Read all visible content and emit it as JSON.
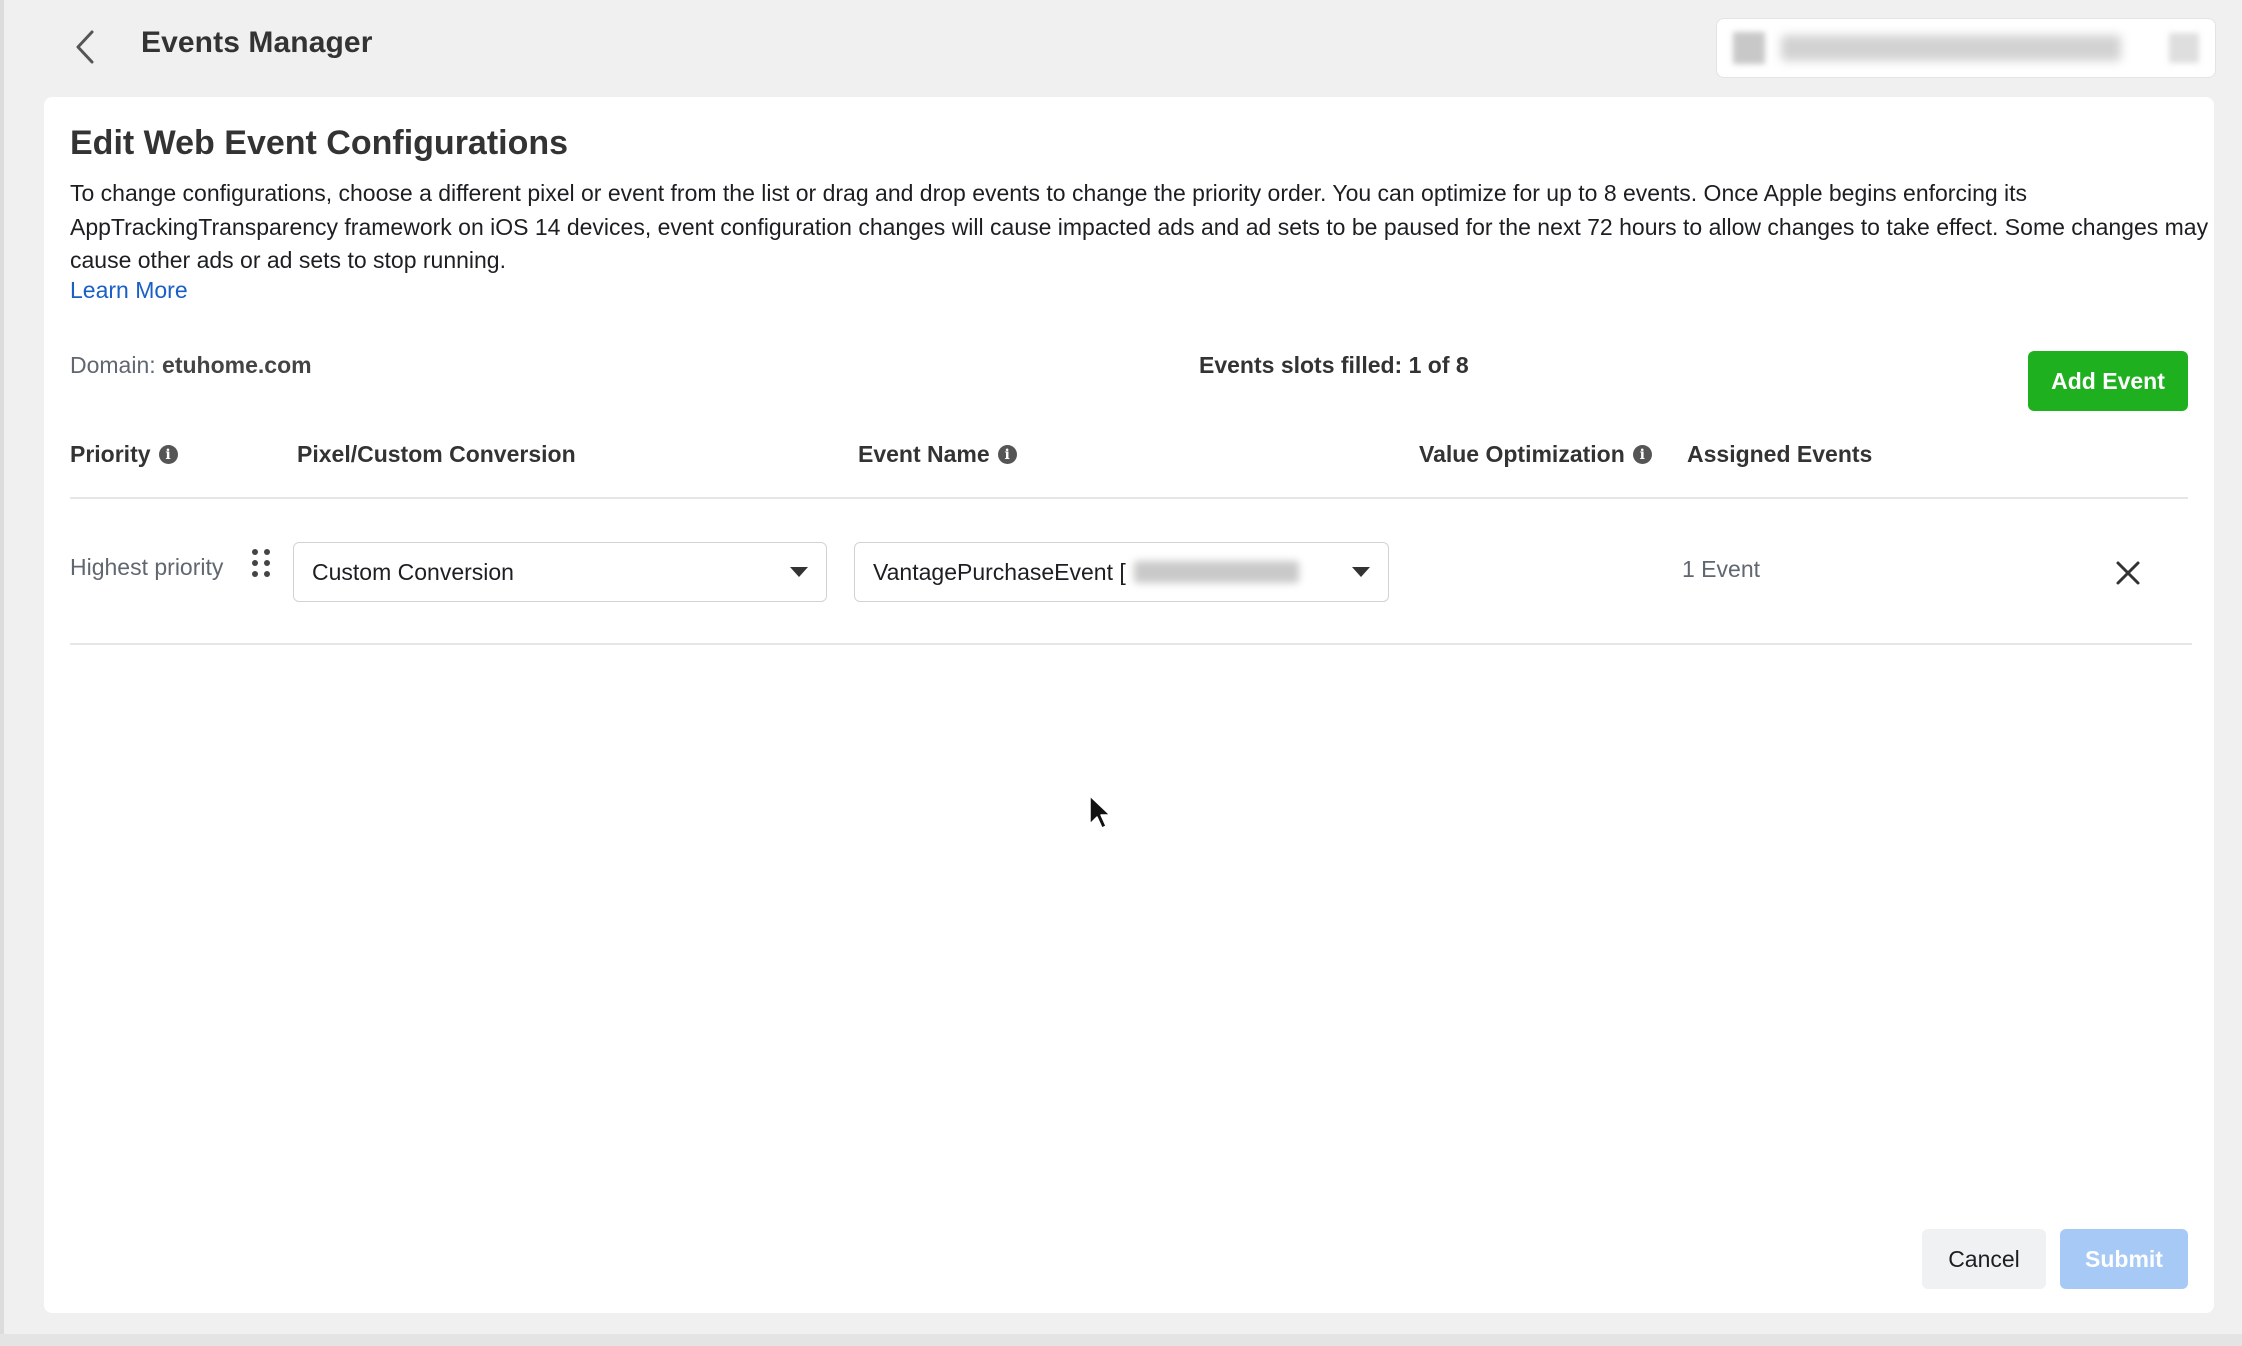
{
  "header": {
    "title": "Events Manager"
  },
  "card": {
    "title": "Edit Web Event Configurations",
    "description": "To change configurations, choose a different pixel or event from the list or drag and drop events to change the priority order. You can optimize for up to 8 events. Once Apple begins enforcing its AppTrackingTransparency framework on iOS 14 devices, event configuration changes will cause impacted ads and ad sets to be paused for the next 72 hours to allow changes to take effect. Some changes may cause other ads or ad sets to stop running.",
    "learn_more": "Learn More",
    "domain_label": "Domain:",
    "domain_value": "etuhome.com",
    "slots_filled": "Events slots filled: 1 of 8",
    "add_event": "Add Event"
  },
  "table": {
    "columns": {
      "priority": "Priority",
      "pixel": "Pixel/Custom Conversion",
      "event_name": "Event Name",
      "value_optimization": "Value Optimization",
      "assigned_events": "Assigned Events"
    },
    "rows": [
      {
        "priority": "Highest priority",
        "pixel": "Custom Conversion",
        "event_name": "VantagePurchaseEvent [",
        "assigned": "1 Event"
      }
    ]
  },
  "footer": {
    "cancel": "Cancel",
    "submit": "Submit"
  },
  "colors": {
    "add_event_green": "#1fb01f",
    "submit_disabled_blue": "#a6c9f5",
    "link_blue": "#1a5fc5"
  }
}
